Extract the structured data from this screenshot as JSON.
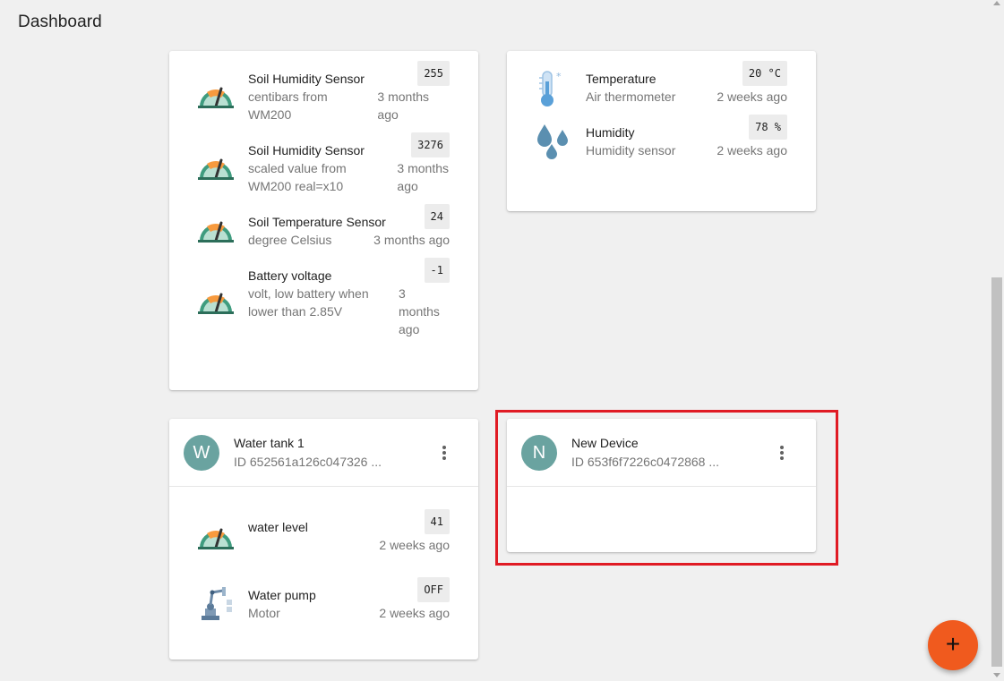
{
  "page": {
    "title": "Dashboard"
  },
  "colors": {
    "accent": "#f05a1e",
    "avatar": "#6aa3a0",
    "highlight": "#e01b24"
  },
  "soil_card": {
    "sensors": [
      {
        "icon": "gauge-icon",
        "name": "Soil Humidity Sensor",
        "desc1": "centibars from",
        "desc2": "WM200",
        "value": "255",
        "time1": "3 months",
        "time2": "ago"
      },
      {
        "icon": "gauge-icon",
        "name": "Soil Humidity Sensor",
        "desc1": "scaled value from",
        "desc2": "WM200 real=x10",
        "value": "3276",
        "time1": "3 months",
        "time2": "ago"
      },
      {
        "icon": "gauge-icon",
        "name": "Soil Temperature Sensor",
        "desc1": "degree Celsius",
        "value": "24",
        "time1": "3 months ago"
      },
      {
        "icon": "gauge-icon",
        "name": "Battery voltage",
        "desc1": "volt, low battery when",
        "desc2": "lower than 2.85V",
        "value": "-1",
        "time1": "3",
        "time2": "months",
        "time3": "ago"
      }
    ]
  },
  "climate_card": {
    "sensors": [
      {
        "icon": "thermometer-icon",
        "name": "Temperature",
        "desc1": "Air thermometer",
        "value": "20 °C",
        "time1": "2 weeks ago"
      },
      {
        "icon": "water-drops-icon",
        "name": "Humidity",
        "desc1": "Humidity sensor",
        "value": "78 %",
        "time1": "2 weeks ago"
      }
    ]
  },
  "water_tank_card": {
    "avatar": "W",
    "name": "Water tank 1",
    "id": "ID 652561a126c047326 ...",
    "sensors": [
      {
        "icon": "gauge-icon",
        "name": "water level",
        "value": "41",
        "time1": "2 weeks ago"
      },
      {
        "icon": "robot-arm-icon",
        "name": "Water pump",
        "desc1": "Motor",
        "value": "OFF",
        "time1": "2 weeks ago"
      }
    ]
  },
  "new_device_card": {
    "avatar": "N",
    "name": "New Device",
    "id": "ID 653f6f7226c0472868 ..."
  },
  "fab": {
    "label": "+"
  }
}
